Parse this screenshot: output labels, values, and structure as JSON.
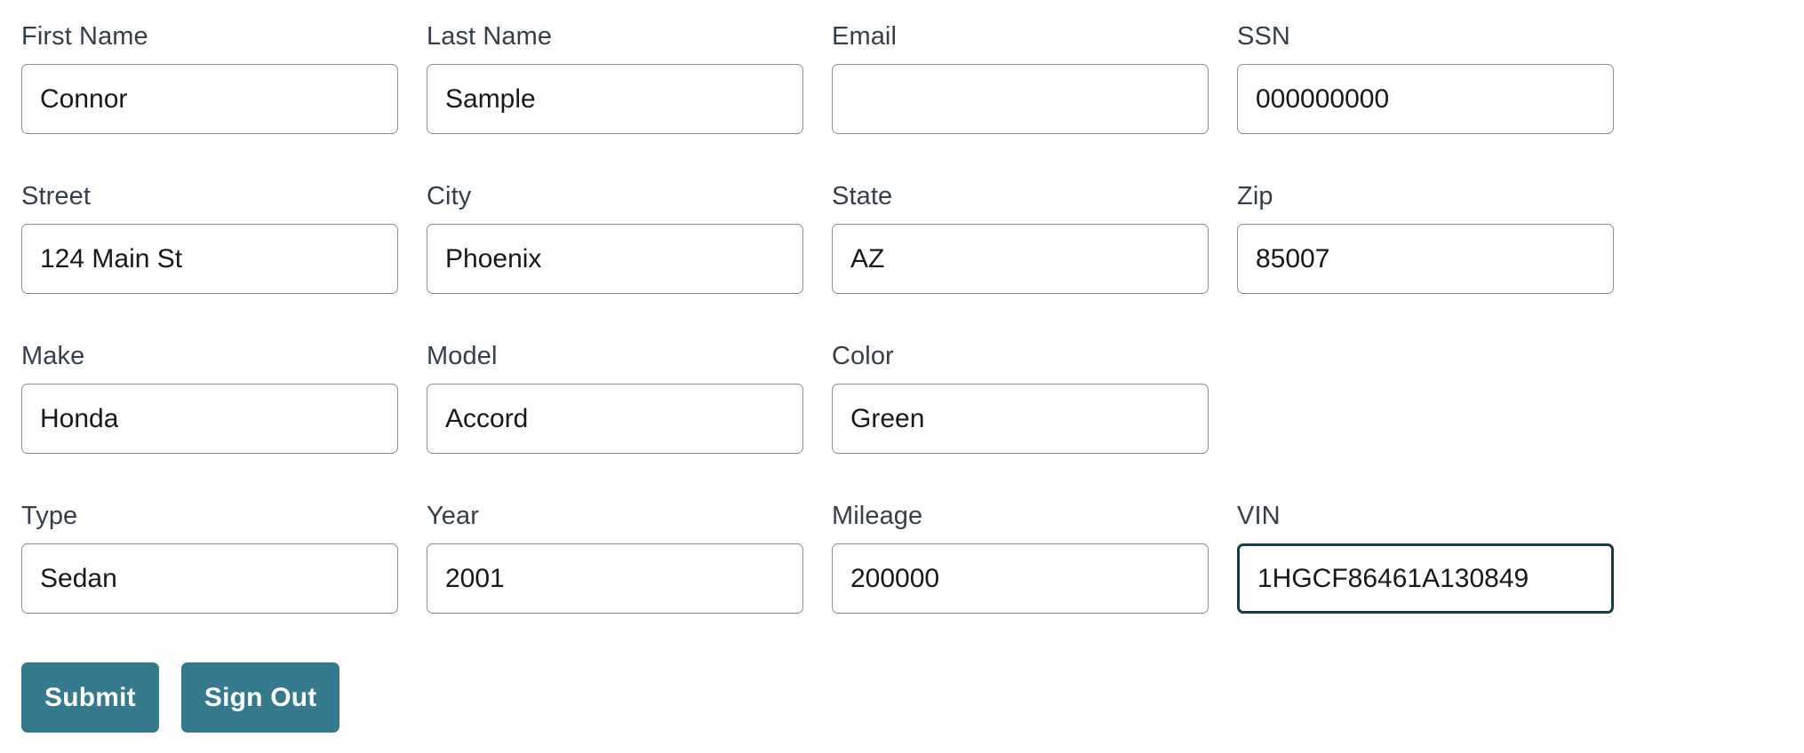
{
  "theme": {
    "page_background": "#ffffff",
    "label_color": "#343f4b",
    "value_color": "#15181c",
    "input_border": "#868e96",
    "input_border_focused": "#1b3a47",
    "button_background": "#35798c",
    "button_text": "#ffffff"
  },
  "form": {
    "rows": [
      {
        "fields": [
          {
            "label": "First Name",
            "value": "Connor",
            "name": "first-name",
            "focused": false,
            "empty": false
          },
          {
            "label": "Last Name",
            "value": "Sample",
            "name": "last-name",
            "focused": false,
            "empty": false
          },
          {
            "label": "Email",
            "value": "",
            "name": "email",
            "focused": false,
            "empty": true
          },
          {
            "label": "SSN",
            "value": "000000000",
            "name": "ssn",
            "focused": false,
            "empty": false
          }
        ]
      },
      {
        "fields": [
          {
            "label": "Street",
            "value": "124 Main St",
            "name": "street",
            "focused": false,
            "empty": false
          },
          {
            "label": "City",
            "value": "Phoenix",
            "name": "city",
            "focused": false,
            "empty": false
          },
          {
            "label": "State",
            "value": "AZ",
            "name": "state",
            "focused": false,
            "empty": false
          },
          {
            "label": "Zip",
            "value": "85007",
            "name": "zip",
            "focused": false,
            "empty": false
          }
        ]
      },
      {
        "fields": [
          {
            "label": "Make",
            "value": "Honda",
            "name": "make",
            "focused": false,
            "empty": false
          },
          {
            "label": "Model",
            "value": "Accord",
            "name": "model",
            "focused": false,
            "empty": false
          },
          {
            "label": "Color",
            "value": "Green",
            "name": "color",
            "focused": false,
            "empty": false
          },
          {
            "label": "",
            "value": "",
            "name": "spacer",
            "focused": false,
            "empty": true,
            "hidden": true
          }
        ]
      },
      {
        "fields": [
          {
            "label": "Type",
            "value": "Sedan",
            "name": "type",
            "focused": false,
            "empty": false
          },
          {
            "label": "Year",
            "value": "2001",
            "name": "year",
            "focused": false,
            "empty": false
          },
          {
            "label": "Mileage",
            "value": "200000",
            "name": "mileage",
            "focused": false,
            "empty": false
          },
          {
            "label": "VIN",
            "value": "1HGCF86461A130849",
            "name": "vin",
            "focused": true,
            "empty": false
          }
        ]
      }
    ]
  },
  "actions": {
    "submit_label": "Submit",
    "sign_out_label": "Sign Out"
  }
}
